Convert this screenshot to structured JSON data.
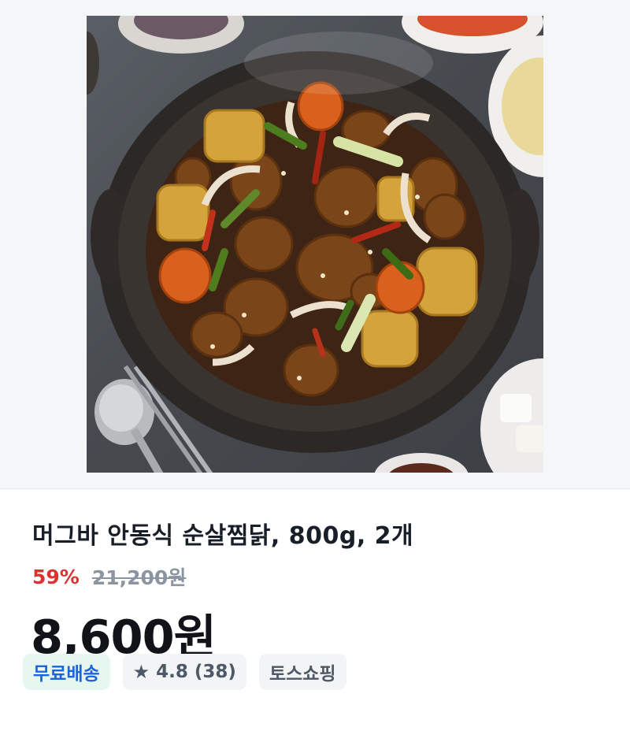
{
  "product": {
    "image_alt": "안동식 순살찜닭 사진",
    "title": "머그바 안동식 순살찜닭, 800g, 2개",
    "discount_rate": "59%",
    "original_price": "21,200원",
    "price": "8,600원"
  },
  "badges": {
    "shipping": "무료배송",
    "rating_icon": "star-icon",
    "rating": "4.8 (38)",
    "store": "토스쇼핑"
  },
  "colors": {
    "discount": "#e03131",
    "shipping_text": "#1b64da",
    "shipping_bg": "#e6f7ef"
  }
}
